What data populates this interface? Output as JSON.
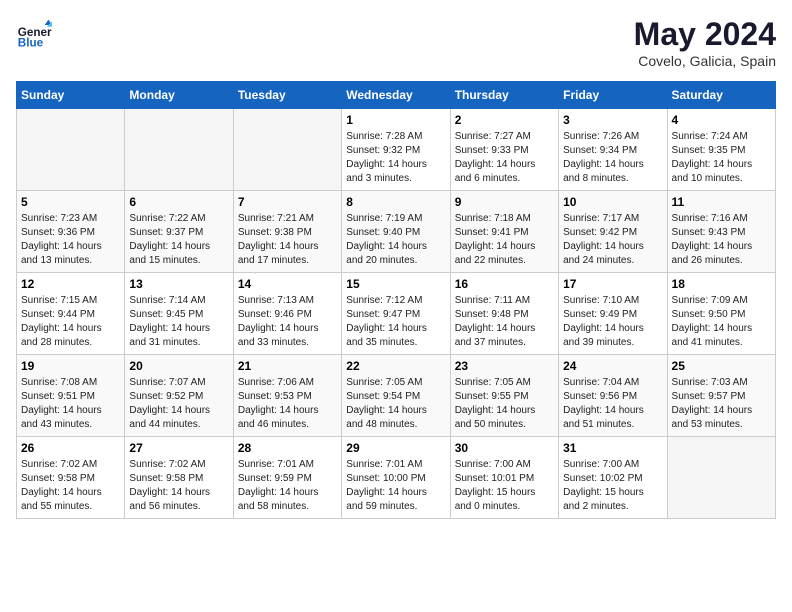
{
  "header": {
    "logo_line1": "General",
    "logo_line2": "Blue",
    "title": "May 2024",
    "subtitle": "Covelo, Galicia, Spain"
  },
  "weekdays": [
    "Sunday",
    "Monday",
    "Tuesday",
    "Wednesday",
    "Thursday",
    "Friday",
    "Saturday"
  ],
  "weeks": [
    [
      {
        "day": "",
        "info": ""
      },
      {
        "day": "",
        "info": ""
      },
      {
        "day": "",
        "info": ""
      },
      {
        "day": "1",
        "info": "Sunrise: 7:28 AM\nSunset: 9:32 PM\nDaylight: 14 hours\nand 3 minutes."
      },
      {
        "day": "2",
        "info": "Sunrise: 7:27 AM\nSunset: 9:33 PM\nDaylight: 14 hours\nand 6 minutes."
      },
      {
        "day": "3",
        "info": "Sunrise: 7:26 AM\nSunset: 9:34 PM\nDaylight: 14 hours\nand 8 minutes."
      },
      {
        "day": "4",
        "info": "Sunrise: 7:24 AM\nSunset: 9:35 PM\nDaylight: 14 hours\nand 10 minutes."
      }
    ],
    [
      {
        "day": "5",
        "info": "Sunrise: 7:23 AM\nSunset: 9:36 PM\nDaylight: 14 hours\nand 13 minutes."
      },
      {
        "day": "6",
        "info": "Sunrise: 7:22 AM\nSunset: 9:37 PM\nDaylight: 14 hours\nand 15 minutes."
      },
      {
        "day": "7",
        "info": "Sunrise: 7:21 AM\nSunset: 9:38 PM\nDaylight: 14 hours\nand 17 minutes."
      },
      {
        "day": "8",
        "info": "Sunrise: 7:19 AM\nSunset: 9:40 PM\nDaylight: 14 hours\nand 20 minutes."
      },
      {
        "day": "9",
        "info": "Sunrise: 7:18 AM\nSunset: 9:41 PM\nDaylight: 14 hours\nand 22 minutes."
      },
      {
        "day": "10",
        "info": "Sunrise: 7:17 AM\nSunset: 9:42 PM\nDaylight: 14 hours\nand 24 minutes."
      },
      {
        "day": "11",
        "info": "Sunrise: 7:16 AM\nSunset: 9:43 PM\nDaylight: 14 hours\nand 26 minutes."
      }
    ],
    [
      {
        "day": "12",
        "info": "Sunrise: 7:15 AM\nSunset: 9:44 PM\nDaylight: 14 hours\nand 28 minutes."
      },
      {
        "day": "13",
        "info": "Sunrise: 7:14 AM\nSunset: 9:45 PM\nDaylight: 14 hours\nand 31 minutes."
      },
      {
        "day": "14",
        "info": "Sunrise: 7:13 AM\nSunset: 9:46 PM\nDaylight: 14 hours\nand 33 minutes."
      },
      {
        "day": "15",
        "info": "Sunrise: 7:12 AM\nSunset: 9:47 PM\nDaylight: 14 hours\nand 35 minutes."
      },
      {
        "day": "16",
        "info": "Sunrise: 7:11 AM\nSunset: 9:48 PM\nDaylight: 14 hours\nand 37 minutes."
      },
      {
        "day": "17",
        "info": "Sunrise: 7:10 AM\nSunset: 9:49 PM\nDaylight: 14 hours\nand 39 minutes."
      },
      {
        "day": "18",
        "info": "Sunrise: 7:09 AM\nSunset: 9:50 PM\nDaylight: 14 hours\nand 41 minutes."
      }
    ],
    [
      {
        "day": "19",
        "info": "Sunrise: 7:08 AM\nSunset: 9:51 PM\nDaylight: 14 hours\nand 43 minutes."
      },
      {
        "day": "20",
        "info": "Sunrise: 7:07 AM\nSunset: 9:52 PM\nDaylight: 14 hours\nand 44 minutes."
      },
      {
        "day": "21",
        "info": "Sunrise: 7:06 AM\nSunset: 9:53 PM\nDaylight: 14 hours\nand 46 minutes."
      },
      {
        "day": "22",
        "info": "Sunrise: 7:05 AM\nSunset: 9:54 PM\nDaylight: 14 hours\nand 48 minutes."
      },
      {
        "day": "23",
        "info": "Sunrise: 7:05 AM\nSunset: 9:55 PM\nDaylight: 14 hours\nand 50 minutes."
      },
      {
        "day": "24",
        "info": "Sunrise: 7:04 AM\nSunset: 9:56 PM\nDaylight: 14 hours\nand 51 minutes."
      },
      {
        "day": "25",
        "info": "Sunrise: 7:03 AM\nSunset: 9:57 PM\nDaylight: 14 hours\nand 53 minutes."
      }
    ],
    [
      {
        "day": "26",
        "info": "Sunrise: 7:02 AM\nSunset: 9:58 PM\nDaylight: 14 hours\nand 55 minutes."
      },
      {
        "day": "27",
        "info": "Sunrise: 7:02 AM\nSunset: 9:58 PM\nDaylight: 14 hours\nand 56 minutes."
      },
      {
        "day": "28",
        "info": "Sunrise: 7:01 AM\nSunset: 9:59 PM\nDaylight: 14 hours\nand 58 minutes."
      },
      {
        "day": "29",
        "info": "Sunrise: 7:01 AM\nSunset: 10:00 PM\nDaylight: 14 hours\nand 59 minutes."
      },
      {
        "day": "30",
        "info": "Sunrise: 7:00 AM\nSunset: 10:01 PM\nDaylight: 15 hours\nand 0 minutes."
      },
      {
        "day": "31",
        "info": "Sunrise: 7:00 AM\nSunset: 10:02 PM\nDaylight: 15 hours\nand 2 minutes."
      },
      {
        "day": "",
        "info": ""
      }
    ]
  ]
}
